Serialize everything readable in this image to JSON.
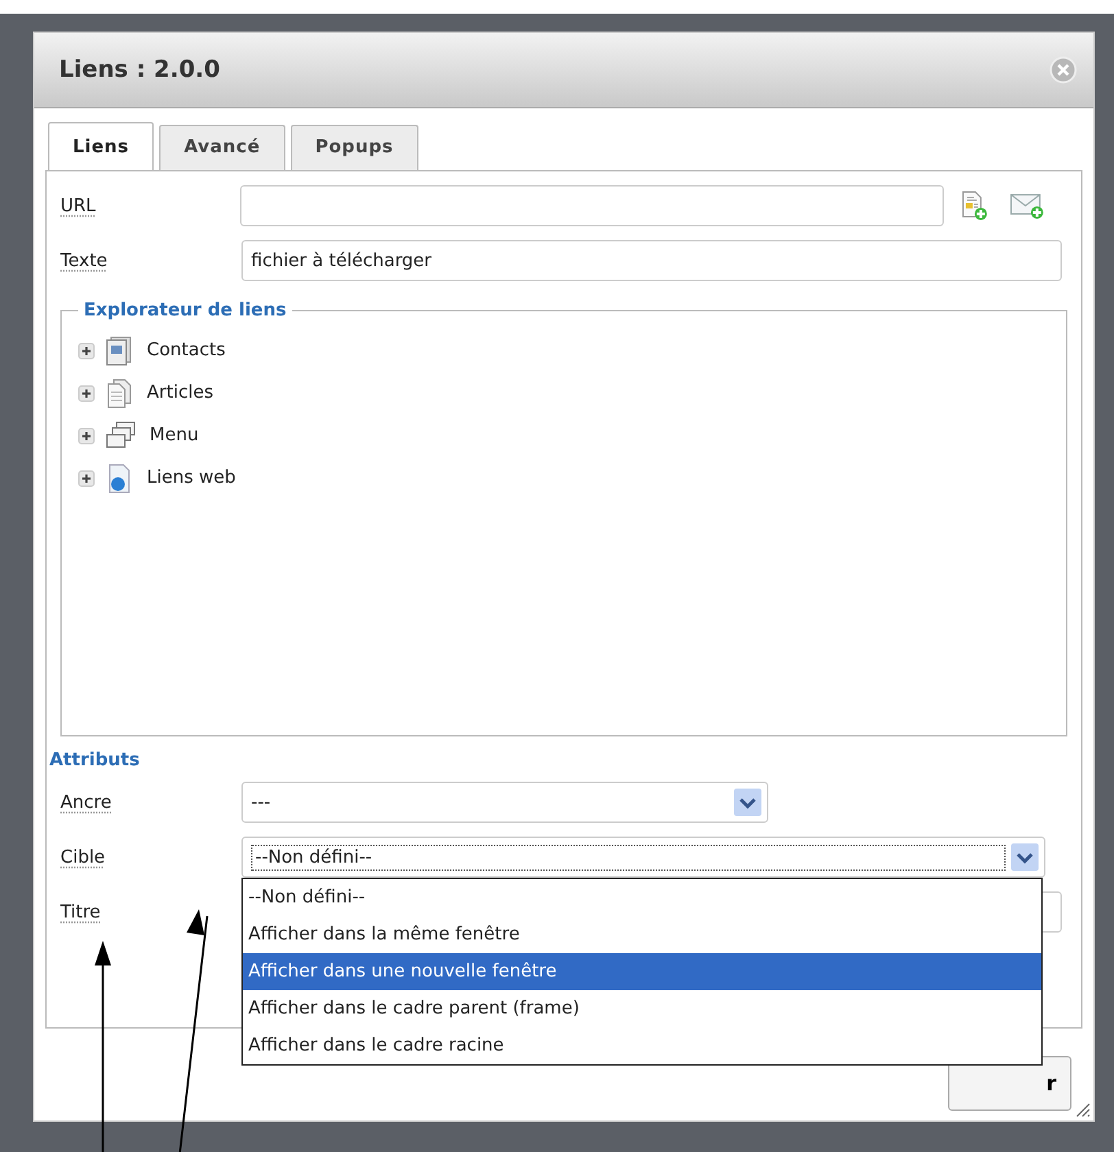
{
  "dialog": {
    "title": "Liens : 2.0.0"
  },
  "tabs": [
    {
      "label": "Liens",
      "selected": true
    },
    {
      "label": "Avancé",
      "selected": false
    },
    {
      "label": "Popups",
      "selected": false
    }
  ],
  "url_field": {
    "label": "URL"
  },
  "text_field": {
    "label": "Texte",
    "value": "fichier à télécharger"
  },
  "link_explorer": {
    "title": "Explorateur de liens",
    "items": [
      {
        "label": "Contacts",
        "kind": "contacts",
        "expanded": false
      },
      {
        "label": "Articles",
        "kind": "articles",
        "expanded": false
      },
      {
        "label": "Menu",
        "kind": "menu",
        "expanded": false
      },
      {
        "label": "Liens web",
        "kind": "web",
        "expanded": false
      }
    ]
  },
  "attributes": {
    "title": "Attributs",
    "anchor": {
      "label": "Ancre",
      "value": "---"
    },
    "target": {
      "label": "Cible",
      "value": "--Non défini--",
      "expanded": true,
      "options": [
        {
          "label": "--Non défini--",
          "highlighted": false
        },
        {
          "label": "Afficher dans la même fenêtre",
          "highlighted": false
        },
        {
          "label": "Afficher dans une nouvelle fenêtre",
          "highlighted": true
        },
        {
          "label": "Afficher dans le cadre parent (frame)",
          "highlighted": false
        },
        {
          "label": "Afficher dans le cadre racine",
          "highlighted": false
        }
      ]
    },
    "title_field": {
      "label": "Titre"
    }
  },
  "buttons": [
    {
      "label": "r"
    }
  ]
}
